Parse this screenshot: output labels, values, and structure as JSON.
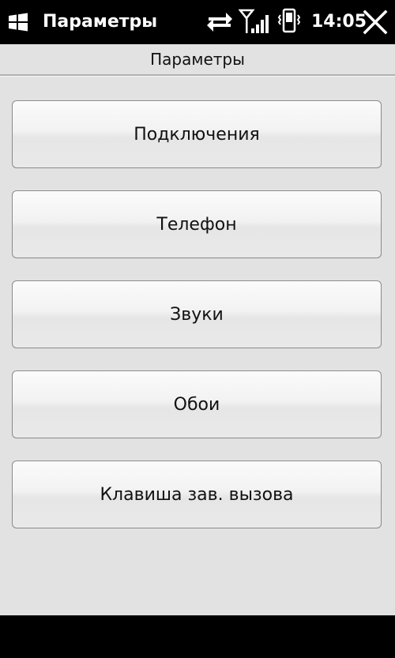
{
  "titlebar": {
    "app_title": "Параметры",
    "clock": "14:05",
    "icons": [
      "windows-start-icon",
      "data-connection-icon",
      "signal-strength-icon",
      "vibrate-icon",
      "close-icon"
    ]
  },
  "page": {
    "title": "Параметры"
  },
  "menu": {
    "items": [
      {
        "label": "Подключения"
      },
      {
        "label": "Телефон"
      },
      {
        "label": "Звуки"
      },
      {
        "label": "Обои"
      },
      {
        "label": "Клавиша зав. вызова"
      }
    ]
  },
  "colors": {
    "background": "#e2e2e2",
    "titlebar": "#000000",
    "button_border": "#8a8a8a"
  }
}
